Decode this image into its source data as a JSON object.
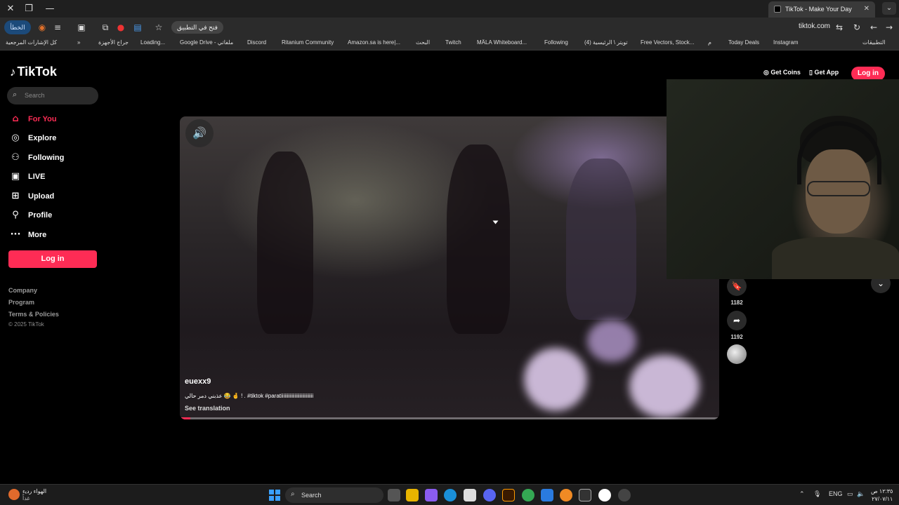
{
  "browser": {
    "tab_title": "TikTok - Make Your Day",
    "error_label": "الخطأ",
    "open_in_app": "فتح في التطبيق",
    "url": "tiktok.com",
    "bookmarks": [
      "كل الإشارات المرجعية",
      "جراج الأجهزة",
      "Loading...",
      "Google Drive - ملفاتي",
      "Discord",
      "Ritanium Community",
      "Amazon.sa is here|...",
      "البحث",
      "Twitch",
      "MÄLA Whiteboard...",
      "Following",
      "(4) تويتر \\ الرئيسية",
      "Free Vectors, Stock...",
      "م",
      "Today Deals",
      "Instagram",
      "التطبيقات"
    ]
  },
  "tiktok": {
    "logo": "TikTok",
    "search_placeholder": "Search",
    "nav": {
      "for_you": "For You",
      "explore": "Explore",
      "following": "Following",
      "live": "LIVE",
      "upload": "Upload",
      "profile": "Profile",
      "more": "More"
    },
    "login_label": "Log in",
    "footer": {
      "company": "Company",
      "program": "Program",
      "terms": "Terms & Policies",
      "copyright": "© 2025 TikTok"
    },
    "top_actions": {
      "get_coins": "Get Coins",
      "get_app": "Get App",
      "login": "Log in"
    },
    "video": {
      "author": "euexx9",
      "caption": "عذبني دمر حالي 😂 🤞 ! . #tiktok #paratiiiiiiiiiiiiiiiiiiiiiiiiii",
      "see_translation": "See translation",
      "progress": 0.02,
      "save_count": "1182",
      "share_count": "1192"
    }
  },
  "taskbar": {
    "weather_title": "الهواء ردي‍ء",
    "weather_sub": "غداً",
    "search_label": "Search",
    "lang": "ENG",
    "time": "١٢:٣٥ ص",
    "date": "٢٧/٠٧/١١"
  },
  "colors": {
    "accent": "#fe2c55",
    "background": "#000000"
  }
}
